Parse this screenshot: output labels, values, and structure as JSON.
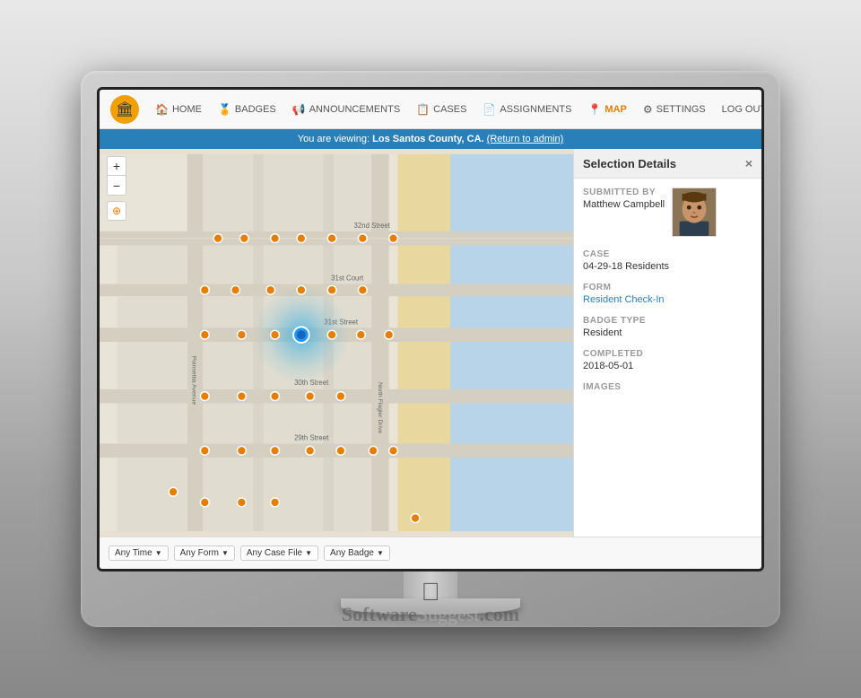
{
  "monitor": {
    "watermark": "SoftwareSuggest.com"
  },
  "navbar": {
    "logo_icon": "🏛",
    "items": [
      {
        "label": "HOME",
        "icon": "🏠",
        "active": false
      },
      {
        "label": "BADGES",
        "icon": "🏅",
        "active": false
      },
      {
        "label": "ANNOUNCEMENTS",
        "icon": "📢",
        "active": false
      },
      {
        "label": "CASES",
        "icon": "📋",
        "active": false
      },
      {
        "label": "ASSIGNMENTS",
        "icon": "📄",
        "active": false
      },
      {
        "label": "MAP",
        "icon": "📍",
        "active": true
      },
      {
        "label": "SETTINGS",
        "icon": "⚙",
        "active": false
      },
      {
        "label": "LOG OUT",
        "icon": "",
        "active": false
      }
    ]
  },
  "announcement_bar": {
    "text_prefix": "You are viewing: ",
    "location": "Los Santos County, CA.",
    "link_text": "(Return to admin)"
  },
  "map": {
    "zoom_in": "+",
    "zoom_out": "−",
    "streets": [
      {
        "name": "32nd Street",
        "y_pct": 24
      },
      {
        "name": "31st Court",
        "y_pct": 38
      },
      {
        "name": "31st Street",
        "y_pct": 50
      },
      {
        "name": "30th Street",
        "y_pct": 63
      },
      {
        "name": "29th Street",
        "y_pct": 77
      },
      {
        "name": "North Flagler Drive",
        "x_pct": 73
      }
    ]
  },
  "selection_panel": {
    "title": "Selection Details",
    "close_label": "×",
    "submitted_by_label": "SUBMITTED BY",
    "submitted_by_name": "Matthew Campbell",
    "case_label": "CASE",
    "case_value": "04-29-18 Residents",
    "form_label": "FORM",
    "form_value": "Resident Check-In",
    "badge_type_label": "BADGE TYPE",
    "badge_type_value": "Resident",
    "completed_label": "COMPLETED",
    "completed_value": "2018-05-01",
    "images_label": "IMAGES"
  },
  "filter_bar": {
    "time_label": "Any Time",
    "form_label": "Any Form",
    "case_label": "Any Case File",
    "badge_label": "Any Badge"
  }
}
